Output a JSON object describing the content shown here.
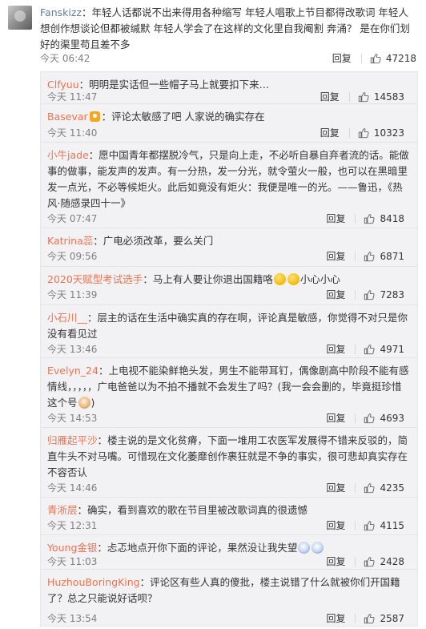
{
  "main_comment": {
    "user": "Fanskizz",
    "text": "：年轻人话都说不出来得用各种缩写  年轻人唱歌上节目都得改歌词  年轻人想创作想谈论但都被缄默  年轻人学会了在这样的文化里自我阉割  奔涌？  是在你们划好的渠里苟且差不多",
    "time": "今天 06:42",
    "reply_label": "回复",
    "likes": "47218"
  },
  "replies": [
    {
      "user": "Clfyuu",
      "text": "：明明是实话但一些帽子马上就要扣下来…",
      "time": "今天 11:47",
      "reply_label": "回复",
      "likes": "14583"
    },
    {
      "user": "Basevar",
      "text": "：评论太敏感了吧 人家说的确实存在",
      "time": "今天 11:40",
      "reply_label": "回复",
      "likes": "10323"
    },
    {
      "user": "小牛jade",
      "text": "：愿中国青年都摆脱冷气，只是向上走，不必听自暴自弃者流的话。能做事的做事，能发声的发声。有一分热，发一分光，就令萤火一般，也可以在黑暗里发一点光，不必等候炬火。此后如竟没有炬火：我便是唯一的光。——鲁迅，《热风·随感录四十一》",
      "time": "今天 07:47",
      "reply_label": "回复",
      "likes": "8418"
    },
    {
      "user": "Katrina蕊",
      "text": "：广电必须改革，要么关门",
      "time": "今天 09:56",
      "reply_label": "回复",
      "likes": "6871"
    },
    {
      "user": "2020天赋型考试选手",
      "text": "：马上有人要让你退出国籍咯",
      "text_after": "小心小心",
      "time": "今天 11:39",
      "reply_label": "回复",
      "likes": "7283"
    },
    {
      "user": "小石川__",
      "text": "：层主的话在生活中确实真的存在啊，评论真是敏感，你觉得不对只是你没有看见过",
      "time": "今天 13:46",
      "reply_label": "回复",
      "likes": "4971"
    },
    {
      "user": "Evelyn_24",
      "text": "：上电视不能染鲜艳头发，男生不能带耳钉，偶像剧高中阶段不能有感情线，，，，，广电爸爸以为不拍不播就不会发生了吗？(我一会会删的，毕竟挺珍惜这个号",
      "text_after": ")",
      "time": "今天 14:53",
      "reply_label": "回复",
      "likes": "4693"
    },
    {
      "user": "归雁起平沙",
      "text": "：楼主说的是文化贫瘠，下面一堆用工农医军发展得不错来反驳的，简直牛头不对马嘴。可惜现在文化萎靡创作裹狂就是不争的事实，很可悲却真实存在不容否认",
      "time": "今天 14:46",
      "reply_label": "回复",
      "likes": "4235"
    },
    {
      "user": "青淅层",
      "text": "：确实，看到喜欢的歌在节目里被改歌词真的很遗憾",
      "time": "今天 12:31",
      "reply_label": "回复",
      "likes": "4115"
    },
    {
      "user": "Young金银",
      "text": "：忐忑地点开你下面的评论，果然没让我失望",
      "time": "今天 11:03",
      "reply_label": "回复",
      "likes": "2428"
    },
    {
      "user": "HuzhouBoringKing",
      "text": "：评论区有些人真的傻批，楼主说错了什么就被你们开国籍了？总之只能说好话呗？",
      "time": "今天 13:54",
      "reply_label": "回复",
      "likes": "2587"
    }
  ]
}
